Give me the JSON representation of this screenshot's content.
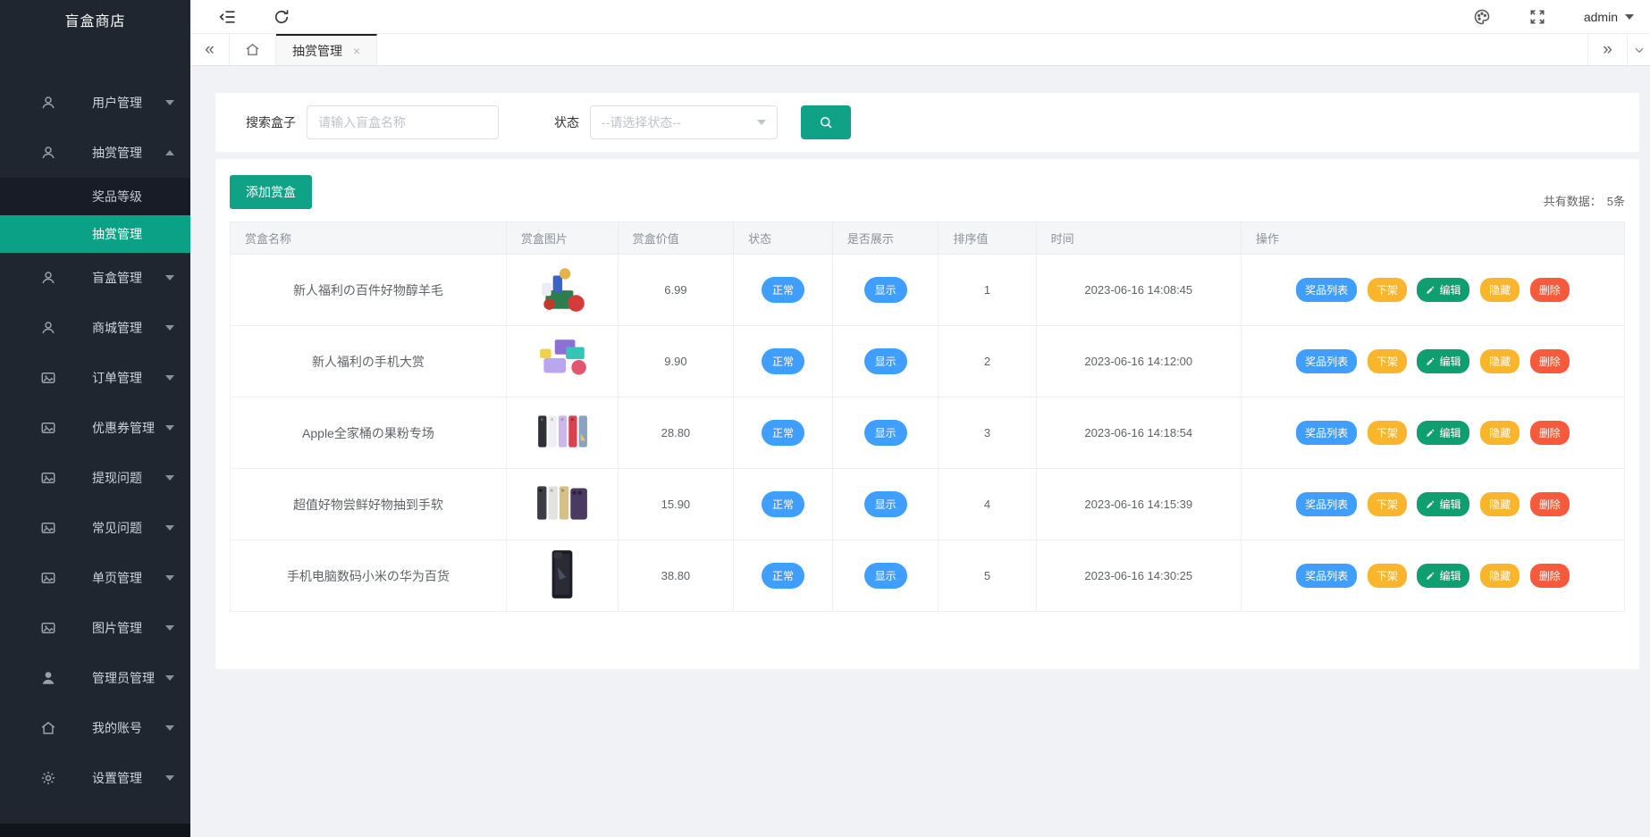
{
  "app": {
    "title": "盲盒商店"
  },
  "topbar": {
    "user": "admin"
  },
  "tabbar": {
    "active_tab": "抽赏管理"
  },
  "icons": {
    "tab_prev": "«",
    "tab_next": "»",
    "tab_close": "×"
  },
  "sidebar": {
    "items": [
      {
        "label": "用户管理"
      },
      {
        "label": "抽赏管理"
      },
      {
        "label": "盲盒管理"
      },
      {
        "label": "商城管理"
      },
      {
        "label": "订单管理"
      },
      {
        "label": "优惠券管理"
      },
      {
        "label": "提现问题"
      },
      {
        "label": "常见问题"
      },
      {
        "label": "单页管理"
      },
      {
        "label": "图片管理"
      },
      {
        "label": "管理员管理"
      },
      {
        "label": "我的账号"
      },
      {
        "label": "设置管理"
      }
    ],
    "lottery_children": [
      {
        "label": "奖品等级"
      },
      {
        "label": "抽赏管理"
      }
    ]
  },
  "filters": {
    "search_label": "搜索盒子",
    "search_placeholder": "请输入盲盒名称",
    "status_label": "状态",
    "status_placeholder": "--请选择状态--"
  },
  "toolbar": {
    "add_button": "添加赏盒"
  },
  "stats": {
    "label": "共有数据：",
    "count": "5条"
  },
  "table": {
    "headers": [
      "赏盒名称",
      "赏盒图片",
      "赏盒价值",
      "状态",
      "是否展示",
      "排序值",
      "时间",
      "操作"
    ],
    "action_labels": {
      "prize_list": "奖品列表",
      "take_down": "下架",
      "edit": "编辑",
      "hide": "隐藏",
      "delete": "删除"
    },
    "rows": [
      {
        "name": "新人福利の百件好物醇羊毛",
        "price": "6.99",
        "status": "正常",
        "show": "显示",
        "sort": "1",
        "time": "2023-06-16 14:08:45"
      },
      {
        "name": "新人福利の手机大赏",
        "price": "9.90",
        "status": "正常",
        "show": "显示",
        "sort": "2",
        "time": "2023-06-16 14:12:00"
      },
      {
        "name": "Apple全家桶の果粉专场",
        "price": "28.80",
        "status": "正常",
        "show": "显示",
        "sort": "3",
        "time": "2023-06-16 14:18:54"
      },
      {
        "name": "超值好物尝鲜好物抽到手软",
        "price": "15.90",
        "status": "正常",
        "show": "显示",
        "sort": "4",
        "time": "2023-06-16 14:15:39"
      },
      {
        "name": "手机电脑数码小米の华为百货",
        "price": "38.80",
        "status": "正常",
        "show": "显示",
        "sort": "5",
        "time": "2023-06-16 14:30:25"
      }
    ]
  },
  "colors": {
    "accent_teal": "#0fa287",
    "primary_blue": "#409eff",
    "warning_amber": "#fbb52d",
    "success_green": "#0f9e6f",
    "danger_red": "#f95a3c",
    "sidebar_bg": "#1f2630"
  }
}
